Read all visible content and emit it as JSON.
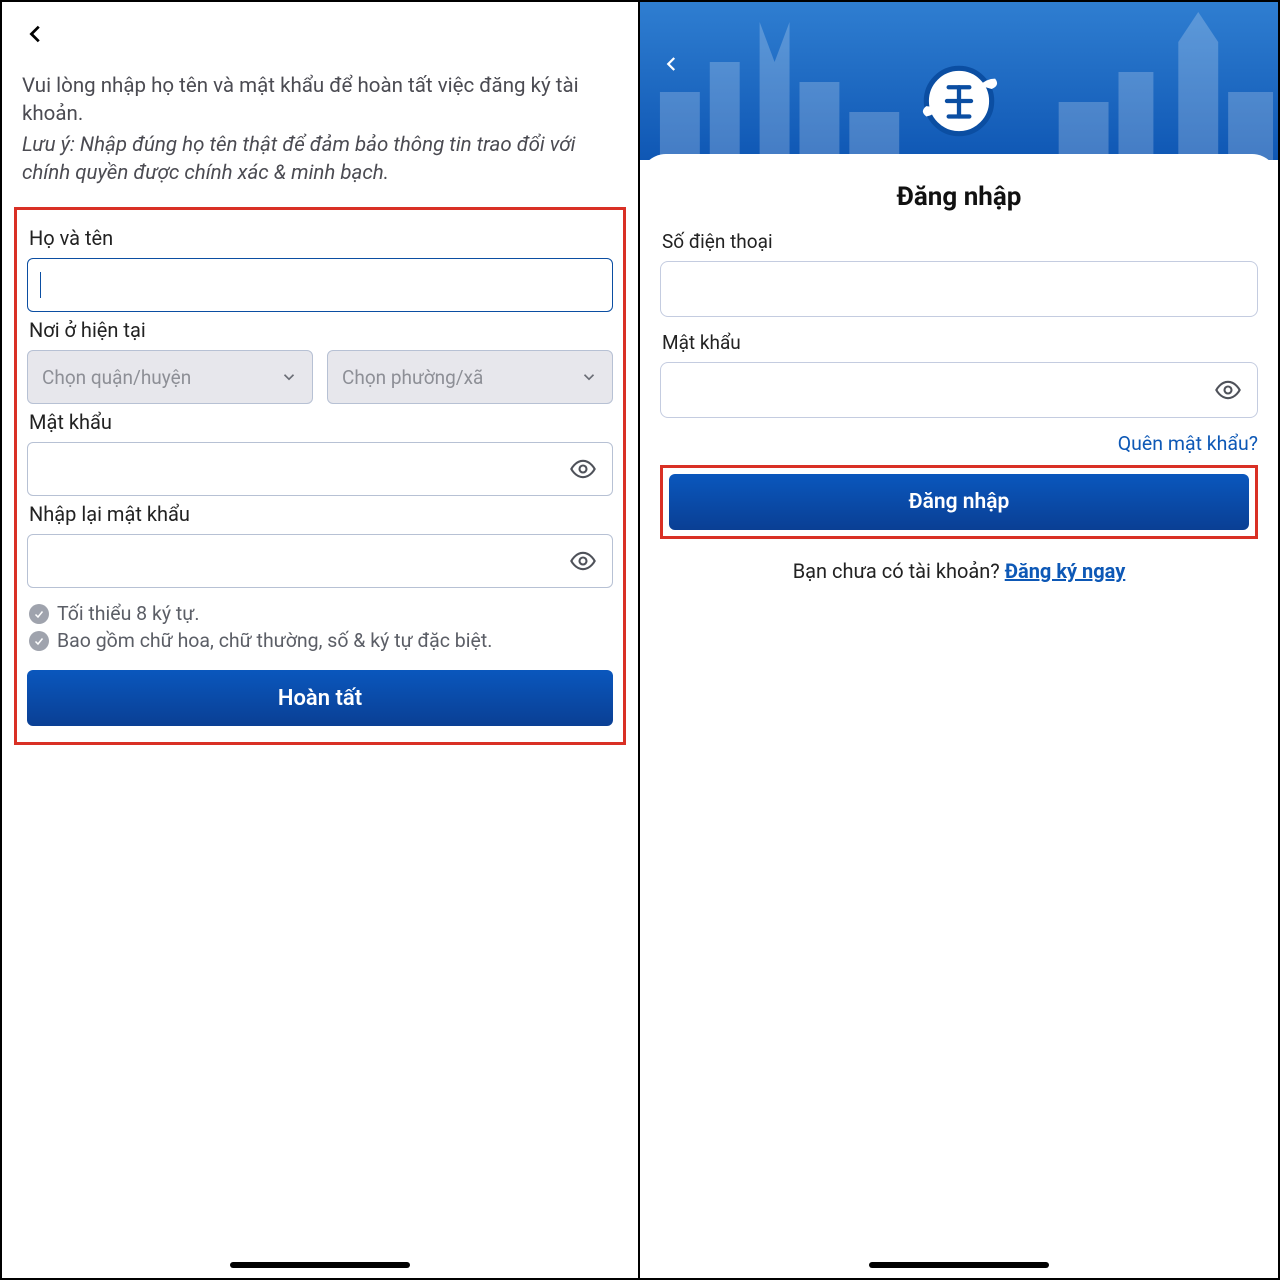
{
  "colors": {
    "accent": "#0a4ea2",
    "highlight": "#d93025"
  },
  "left": {
    "intro": "Vui lòng nhập họ tên và mật khẩu để hoàn tất việc đăng ký tài khoản.",
    "note": "Lưu ý: Nhập đúng họ tên thật để đảm bảo thông tin trao đổi với chính quyền được chính xác & minh bạch.",
    "name_label": "Họ và tên",
    "name_value": "",
    "location_label": "Nơi ở hiện tại",
    "district_placeholder": "Chọn quận/huyện",
    "ward_placeholder": "Chọn phường/xã",
    "password_label": "Mật khẩu",
    "password2_label": "Nhập lại mật khẩu",
    "req1": "Tối thiểu 8 ký tự.",
    "req2": "Bao gồm chữ hoa, chữ thường, số & ký tự đặc biệt.",
    "submit": "Hoàn tất"
  },
  "right": {
    "title": "Đăng nhập",
    "phone_label": "Số điện thoại",
    "password_label": "Mật khẩu",
    "forgot": "Quên mật khẩu?",
    "login": "Đăng nhập",
    "no_account_prefix": "Bạn chưa có tài khoản? ",
    "register": "Đăng ký ngay"
  }
}
